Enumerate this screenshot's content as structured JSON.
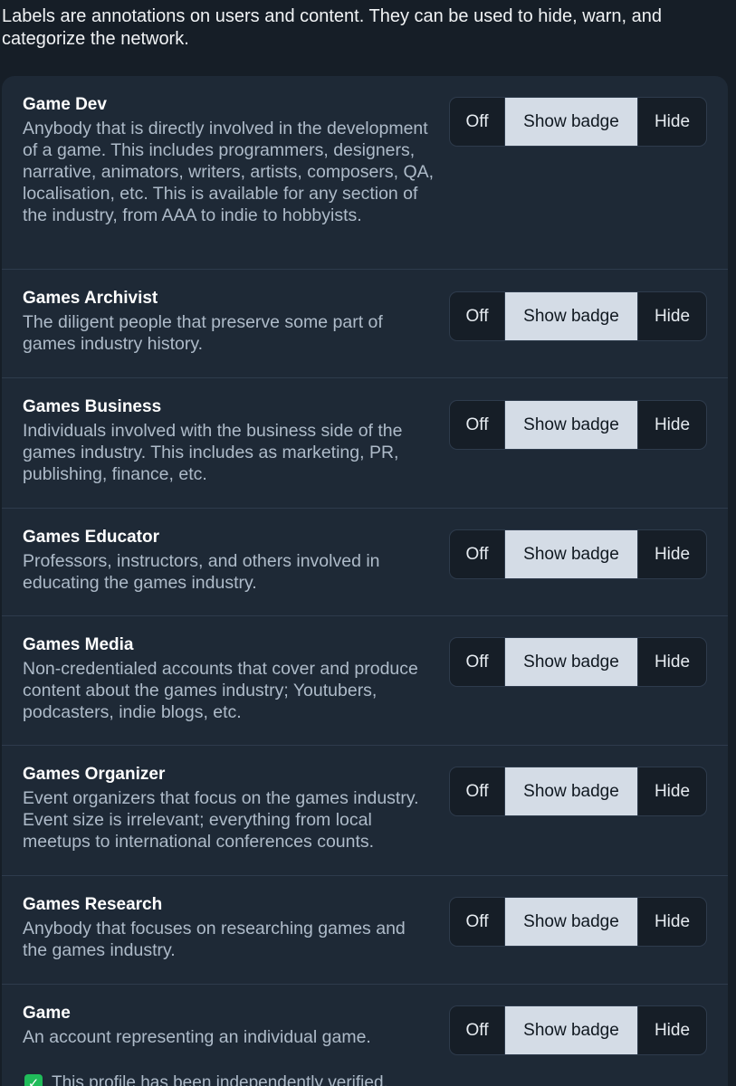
{
  "intro": "Labels are annotations on users and content. They can be used to hide, warn, and categorize the network.",
  "labels": [
    {
      "title": "Game Dev",
      "description": "Anybody that is directly involved in the development of a game. This includes programmers, designers, narrative, animators, writers, artists, composers, QA, localisation, etc. This is available for any section of the industry, from AAA to indie to hobbyists.",
      "options": [
        "Off",
        "Show badge",
        "Hide"
      ],
      "selected": "Show badge"
    },
    {
      "title": "Games Archivist",
      "description": "The diligent people that preserve some part of games industry history.",
      "options": [
        "Off",
        "Show badge",
        "Hide"
      ],
      "selected": "Show badge"
    },
    {
      "title": "Games Business",
      "description": "Individuals involved with the business side of the games industry. This includes as marketing, PR, publishing, finance, etc.",
      "options": [
        "Off",
        "Show badge",
        "Hide"
      ],
      "selected": "Show badge"
    },
    {
      "title": "Games Educator",
      "description": "Professors, instructors, and others involved in educating the games industry.",
      "options": [
        "Off",
        "Show badge",
        "Hide"
      ],
      "selected": "Show badge"
    },
    {
      "title": "Games Media",
      "description": "Non-credentialed accounts that cover and produce content about the games industry; Youtubers, podcasters, indie blogs, etc.",
      "options": [
        "Off",
        "Show badge",
        "Hide"
      ],
      "selected": "Show badge"
    },
    {
      "title": "Games Organizer",
      "description": "Event organizers that focus on the games industry. Event size is irrelevant; everything from local meetups to international conferences counts.",
      "options": [
        "Off",
        "Show badge",
        "Hide"
      ],
      "selected": "Show badge"
    },
    {
      "title": "Games Research",
      "description": "Anybody that focuses on researching games and the games industry.",
      "options": [
        "Off",
        "Show badge",
        "Hide"
      ],
      "selected": "Show badge"
    },
    {
      "title": "Game",
      "description": "An account representing an individual game.",
      "options": [
        "Off",
        "Show badge",
        "Hide"
      ],
      "selected": "Show badge",
      "verified_text": "This profile has been independently verified."
    }
  ],
  "icons": {
    "verified": "check-square-icon"
  },
  "colors": {
    "background": "#161e27",
    "panel": "#1e2936",
    "selected_option": "#d4dce6",
    "verified_check": "#20bc5a"
  }
}
